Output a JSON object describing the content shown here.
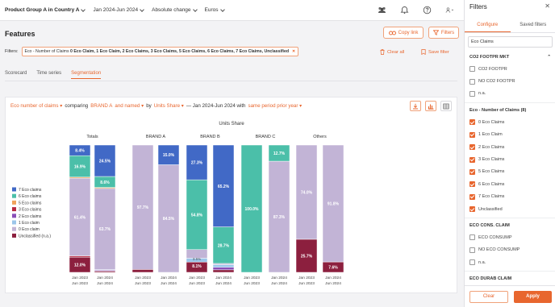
{
  "topbar": {
    "product": "Product Group A in Country A",
    "period": "Jan 2024-Jun 2024",
    "measure": "Absolute change",
    "currency": "Euros"
  },
  "page": {
    "title": "Features",
    "copy_link": "Copy link",
    "filters_btn": "Filters",
    "filters_label": "Filters:",
    "chip_prefix": "Eco - Number of Claims",
    "chip_values": "0 Eco Claim, 1 Eco Claim, 2 Eco Claims, 3 Eco Claims, 5 Eco Claims, 6 Eco Claims, 7 Eco Claims, Unclassified",
    "clear_all": "Clear all",
    "save_filter": "Save filter"
  },
  "tabs": [
    "Scorecard",
    "Time series",
    "Segmentation"
  ],
  "controls": {
    "dimension": "Eco number of claims",
    "comparing": "comparing",
    "brand": "BRAND A",
    "and_named": "and named",
    "by": "by",
    "metric": "Units Share",
    "dash_period": "— Jan 2024-Jun 2024 with",
    "comparison": "same period prior year"
  },
  "chart_data": {
    "type": "bar",
    "stacked": true,
    "normalized": true,
    "title": "Units Share",
    "groups": [
      "Totals",
      "BRAND A",
      "BRAND B",
      "BRAND C",
      "Others"
    ],
    "bar_labels": [
      "Jan 2023\nJun 2023",
      "Jan 2024\nJun 2024"
    ],
    "legend": [
      {
        "name": "7 Eco claims",
        "color": "#4169c6"
      },
      {
        "name": "6 Eco claims",
        "color": "#4bbfa9"
      },
      {
        "name": "5 Eco claims",
        "color": "#f1a35b"
      },
      {
        "name": "3 Eco claims",
        "color": "#b8273f"
      },
      {
        "name": "2 Eco claims",
        "color": "#8a4fb8"
      },
      {
        "name": "1 Eco claim",
        "color": "#9bc6ea"
      },
      {
        "name": "0 Eco claim",
        "color": "#c2b4d6"
      },
      {
        "name": "Unclassified (n.a.)",
        "color": "#8c1f3e"
      }
    ],
    "series_order_bottom_to_top": [
      "Unclassified (n.a.)",
      "3 Eco claims",
      "2 Eco claims",
      "1 Eco claim",
      "0 Eco claim",
      "5 Eco claims",
      "6 Eco claims",
      "7 Eco claims"
    ],
    "bars": [
      {
        "group": "Totals",
        "period": "Jan 2023 Jun 2023",
        "segments": [
          {
            "name": "Unclassified (n.a.)",
            "value": 12.0,
            "label": "12.0%"
          },
          {
            "name": "3 Eco claims",
            "value": 1.0
          },
          {
            "name": "0 Eco claim",
            "value": 61.4,
            "label": "61.4%"
          },
          {
            "name": "5 Eco claims",
            "value": 0.8
          },
          {
            "name": "6 Eco claims",
            "value": 16.9,
            "label": "16.9%"
          },
          {
            "name": "7 Eco claims",
            "value": 8.4,
            "label": "8.4%"
          }
        ]
      },
      {
        "group": "Totals",
        "period": "Jan 2024 Jun 2024",
        "segments": [
          {
            "name": "Unclassified (n.a.)",
            "value": 1.0
          },
          {
            "name": "2 Eco claims",
            "value": 0.7
          },
          {
            "name": "1 Eco claim",
            "value": 0.5
          },
          {
            "name": "0 Eco claim",
            "value": 63.7,
            "label": "63.7%"
          },
          {
            "name": "5 Eco claims",
            "value": 0.8
          },
          {
            "name": "6 Eco claims",
            "value": 8.6,
            "label": "8.6%"
          },
          {
            "name": "7 Eco claims",
            "value": 24.7,
            "label": "24.5%"
          }
        ]
      },
      {
        "group": "BRAND A",
        "period": "Jan 2023 Jun 2023",
        "segments": [
          {
            "name": "Unclassified (n.a.)",
            "value": 2.3
          },
          {
            "name": "0 Eco claim",
            "value": 97.7,
            "label": "97.7%"
          }
        ]
      },
      {
        "group": "BRAND A",
        "period": "Jan 2024 Jun 2024",
        "segments": [
          {
            "name": "0 Eco claim",
            "value": 84.5,
            "label": "84.5%"
          },
          {
            "name": "7 Eco claims",
            "value": 15.5,
            "label": "15.0%"
          }
        ]
      },
      {
        "group": "BRAND B",
        "period": "Jan 2023 Jun 2023",
        "segments": [
          {
            "name": "Unclassified (n.a.)",
            "value": 8.1
          },
          {
            "name": "1 Eco claim",
            "value": 3.0
          },
          {
            "name": "0 Eco claim",
            "value": 6.8
          },
          {
            "name": "6 Eco claims",
            "value": 54.8,
            "label": "54.8%"
          },
          {
            "name": "7 Eco claims",
            "value": 27.3,
            "label": "27.3%"
          }
        ]
      },
      {
        "group": "BRAND B",
        "period": "Jan 2024 Jun 2024",
        "segments": [
          {
            "name": "Unclassified (n.a.)",
            "value": 2.0
          },
          {
            "name": "2 Eco claims",
            "value": 2.0
          },
          {
            "name": "1 Eco claim",
            "value": 2.0
          },
          {
            "name": "0 Eco claim",
            "value": 1.0
          },
          {
            "name": "6 Eco claims",
            "value": 28.7,
            "label": "28.7%"
          },
          {
            "name": "7 Eco claims",
            "value": 64.3,
            "label": "65.2%"
          }
        ]
      },
      {
        "group": "BRAND C",
        "period": "Jan 2023 Jun 2023",
        "segments": [
          {
            "name": "6 Eco claims",
            "value": 100.0,
            "label": "100.0%"
          }
        ]
      },
      {
        "group": "BRAND C",
        "period": "Jan 2024 Jun 2024",
        "segments": [
          {
            "name": "0 Eco claim",
            "value": 87.3,
            "label": "87.3%"
          },
          {
            "name": "6 Eco claims",
            "value": 12.7,
            "label": "12.7%"
          }
        ]
      },
      {
        "group": "Others",
        "period": "Jan 2023 Jun 2023",
        "segments": [
          {
            "name": "Unclassified (n.a.)",
            "value": 26.0,
            "label": "25.7%"
          },
          {
            "name": "0 Eco claim",
            "value": 74.0,
            "label": "74.0%"
          }
        ]
      },
      {
        "group": "Others",
        "period": "Jan 2024 Jun 2024",
        "segments": [
          {
            "name": "Unclassified (n.a.)",
            "value": 8.2,
            "label": "7.6%"
          },
          {
            "name": "0 Eco claim",
            "value": 91.8,
            "label": "91.8%"
          }
        ]
      }
    ],
    "extra_labels": [
      {
        "bar": 4,
        "text": "8.1%"
      },
      {
        "bar": 4,
        "text": "3.5%"
      }
    ]
  },
  "panel": {
    "title": "Filters",
    "tabs": [
      "Configure",
      "Saved filters"
    ],
    "search_value": "Eco Claims",
    "groups": [
      {
        "title": "CO2 FOOTPR MKT",
        "items": [
          {
            "label": "CO2 FOOTPR",
            "checked": false
          },
          {
            "label": "NO CO2 FOOTPR",
            "checked": false
          },
          {
            "label": "n.a.",
            "checked": false
          }
        ]
      },
      {
        "title": "Eco - Number of Claims (8)",
        "items": [
          {
            "label": "0 Eco Claims",
            "checked": true
          },
          {
            "label": "1 Eco Claim",
            "checked": true
          },
          {
            "label": "2 Eco Claims",
            "checked": true
          },
          {
            "label": "3 Eco Claims",
            "checked": true
          },
          {
            "label": "5 Eco Claims",
            "checked": true
          },
          {
            "label": "6 Eco Claims",
            "checked": true
          },
          {
            "label": "7 Eco Claims",
            "checked": true
          },
          {
            "label": "Unclassified",
            "checked": true
          }
        ]
      },
      {
        "title": "ECO CONS. CLAIM",
        "items": [
          {
            "label": "ECO CONSUMP",
            "checked": false
          },
          {
            "label": "NO ECO CONSUMP",
            "checked": false
          },
          {
            "label": "n.a.",
            "checked": false
          }
        ]
      },
      {
        "title": "ECO DURAB CLAIM",
        "items": []
      }
    ],
    "clear": "Clear",
    "apply": "Apply"
  },
  "colors": {
    "accent": "#e8662e"
  }
}
